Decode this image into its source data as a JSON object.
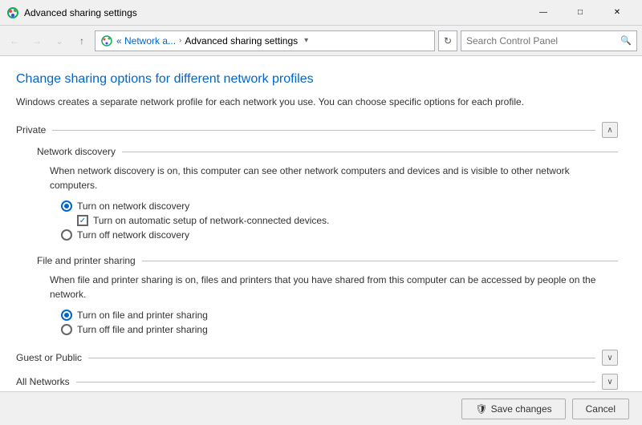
{
  "window": {
    "title": "Advanced sharing settings",
    "minimize": "—",
    "maximize": "□",
    "close": "✕"
  },
  "address_bar": {
    "back_disabled": true,
    "forward_disabled": true,
    "up_label": "↑",
    "breadcrumb_icon": "🌐",
    "breadcrumb_prefix": "« Network a...",
    "breadcrumb_separator": "›",
    "breadcrumb_current": "Advanced sharing settings",
    "dropdown_arrow": "▾",
    "refresh_icon": "↻",
    "search_placeholder": "Search Control Panel",
    "search_icon": "🔍"
  },
  "page": {
    "title": "Change sharing options for different network profiles",
    "description": "Windows creates a separate network profile for each network you use. You can choose specific options for each profile."
  },
  "sections": {
    "private": {
      "title": "Private",
      "toggle_icon": "∧",
      "network_discovery": {
        "title": "Network discovery",
        "description": "When network discovery is on, this computer can see other network computers and devices and is visible to other network computers.",
        "options": [
          {
            "id": "turn_on_discovery",
            "label": "Turn on network discovery",
            "checked": true
          },
          {
            "id": "auto_setup",
            "label": "Turn on automatic setup of network-connected devices.",
            "checked": true,
            "is_checkbox": true
          },
          {
            "id": "turn_off_discovery",
            "label": "Turn off network discovery",
            "checked": false
          }
        ]
      },
      "file_printer_sharing": {
        "title": "File and printer sharing",
        "description": "When file and printer sharing is on, files and printers that you have shared from this computer can be accessed by people on the network.",
        "options": [
          {
            "id": "turn_on_sharing",
            "label": "Turn on file and printer sharing",
            "checked": true
          },
          {
            "id": "turn_off_sharing",
            "label": "Turn off file and printer sharing",
            "checked": false
          }
        ]
      }
    },
    "guest_or_public": {
      "title": "Guest or Public",
      "toggle_icon": "∨"
    },
    "all_networks": {
      "title": "All Networks",
      "toggle_icon": "∨"
    }
  },
  "footer": {
    "save_label": "Save changes",
    "cancel_label": "Cancel",
    "shield_icon": "🛡"
  }
}
